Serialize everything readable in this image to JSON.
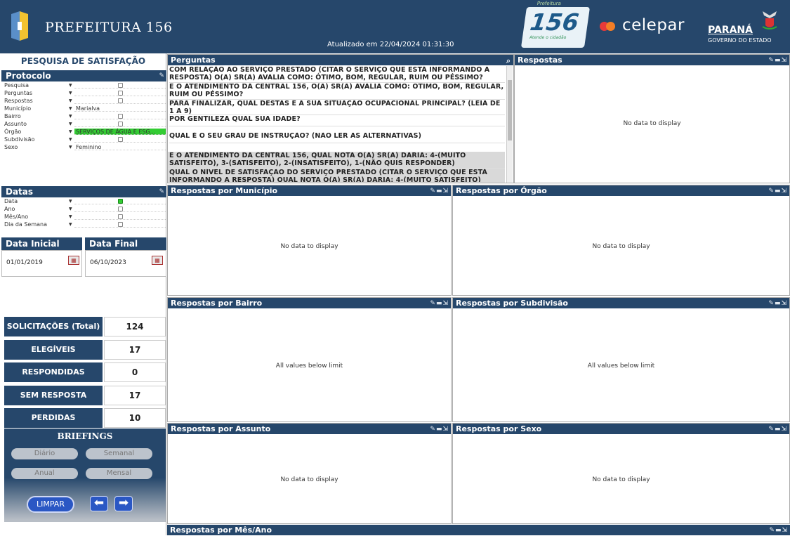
{
  "header": {
    "title": "PREFEITURA 156",
    "updated": "Atualizado em 22/04/2024 01:31:30",
    "badge_number": "156",
    "badge_top": "Prefeitura",
    "badge_sub": "Atende o cidadão",
    "celepar": "celepar",
    "parana": "PARANÁ",
    "governo": "GOVERNO DO ESTADO"
  },
  "left": {
    "section_title": "PESQUISA DE SATISFAÇÃO",
    "protocolo": {
      "label": "Protocolo",
      "rows": [
        {
          "label": "Pesquisa",
          "value": ""
        },
        {
          "label": "Perguntas",
          "value": ""
        },
        {
          "label": "Respostas",
          "value": ""
        },
        {
          "label": "Município",
          "value": "Marialva"
        },
        {
          "label": "Bairro",
          "value": ""
        },
        {
          "label": "Assunto",
          "value": ""
        },
        {
          "label": "Órgão",
          "value": "SERVIÇOS DE ÁGUA E ESG..."
        },
        {
          "label": "Subdivisão",
          "value": ""
        },
        {
          "label": "Sexo",
          "value": "Feminino"
        }
      ]
    },
    "datas": {
      "label": "Datas",
      "rows": [
        {
          "label": "Data"
        },
        {
          "label": "Ano"
        },
        {
          "label": "Mês/Ano"
        },
        {
          "label": "Dia da Semana"
        }
      ]
    },
    "data_inicial": {
      "label": "Data Inicial",
      "value": "01/01/2019"
    },
    "data_final": {
      "label": "Data Final",
      "value": "06/10/2023"
    },
    "kpis": [
      {
        "label": "SOLICITAÇÕES (Total)",
        "value": "124"
      },
      {
        "label": "ELEGÍVEIS",
        "value": "17"
      },
      {
        "label": "RESPONDIDAS",
        "value": "0"
      },
      {
        "label": "SEM RESPOSTA",
        "value": "17"
      },
      {
        "label": "PERDIDAS",
        "value": "10"
      }
    ],
    "briefings": {
      "title": "BRIEFINGS",
      "diario": "Diário",
      "semanal": "Semanal",
      "anual": "Anual",
      "mensal": "Mensal"
    },
    "limpar": "LIMPAR"
  },
  "perguntas": {
    "title": "Perguntas",
    "items": [
      "COM RELAÇÃO AO SERVIÇO PRESTADO (CITAR O SERVIÇO QUE ESTÁ INFORMANDO A RESPOSTA) O(A) SR(A) AVALIA COMO: ÓTIMO, BOM, REGULAR, RUIM OU PÉSSIMO?",
      "E O ATENDIMENTO DA CENTRAL 156, O(A) SR(A) AVALIA COMO: ÓTIMO, BOM, REGULAR, RUIM OU PÉSSIMO?",
      "PARA FINALIZAR, QUAL DESTAS É A SUA SITUAÇÃO OCUPACIONAL PRINCIPAL? (LEIA DE 1 A 9)",
      "POR GENTILEZA QUAL SUA IDADE?",
      "QUAL É O SEU GRAU DE INSTRUÇÃO? (NÃO LER AS ALTERNATIVAS)",
      "E O ATENDIMENTO DA CENTRAL 156, QUAL NOTA O(A) SR(A) DARIA: 4-(MUITO SATISFEITO), 3-(SATISFEITO), 2-(INSATISFEITO), 1-(NÃO QUIS RESPONDER)",
      "QUAL O NÍVEL DE SATISFAÇÃO DO SERVIÇO PRESTADO (CITAR O SERVIÇO QUE ESTÁ INFORMANDO A RESPOSTA) QUAL NOTA O(A) SR(A) DARIA: 4-(MUITO SATISFEITO)"
    ]
  },
  "panels": {
    "respostas": {
      "title": "Respostas",
      "msg": "No data to display"
    },
    "municipio": {
      "title": "Respostas por Município",
      "msg": "No data to display"
    },
    "orgao": {
      "title": "Respostas por Órgão",
      "msg": "No data to display"
    },
    "bairro": {
      "title": "Respostas por Bairro",
      "msg": "All values below limit"
    },
    "subdivisao": {
      "title": "Respostas por Subdivisão",
      "msg": "All values below limit"
    },
    "assunto": {
      "title": "Respostas por Assunto",
      "msg": "No data to display"
    },
    "sexo": {
      "title": "Respostas por Sexo",
      "msg": "No data to display"
    },
    "mesano": {
      "title": "Respostas por Mês/Ano"
    }
  },
  "colors": {
    "navy": "#26476b",
    "selected_green": "#33cc33",
    "button_blue": "#2a57c4"
  }
}
